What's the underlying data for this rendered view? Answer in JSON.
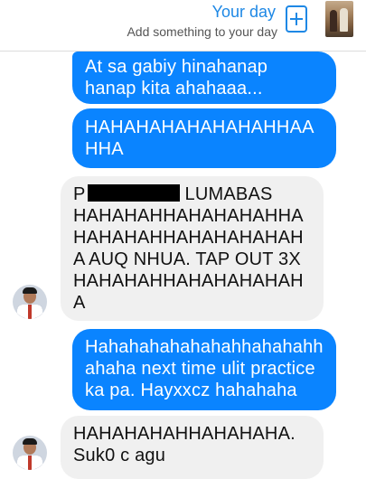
{
  "header": {
    "title": "Your day",
    "subtitle": "Add something to your day",
    "add_icon": "plus-square-icon",
    "thumbnail": "day-story-thumbnail"
  },
  "colors": {
    "accent": "#1e88e5",
    "outgoing_bubble": "#0a84ff",
    "incoming_bubble": "#f0f0f0"
  },
  "messages": [
    {
      "direction": "outgoing",
      "text": "At sa gabiy hinahanap hanap kita ahahaaa..."
    },
    {
      "direction": "outgoing",
      "text": "HAHAHAHAHAHAHAHHAA HHA"
    },
    {
      "direction": "incoming",
      "prefix": "P",
      "text": "LUMABAS HAHAHAHHAHAHAHAHHA HAHAHAHHAHAHAHAHAH A AUQ NHUA. TAP OUT 3X HAHAHAHHAHAHAHAHAH A"
    },
    {
      "direction": "outgoing",
      "text": "Hahahahahahahahhahahahh ahaha next time ulit practice ka pa. Hayxxcz hahahaha"
    },
    {
      "direction": "incoming",
      "text": "HAHAHAHAHHAHAHAHA. Suk0 c agu"
    }
  ]
}
